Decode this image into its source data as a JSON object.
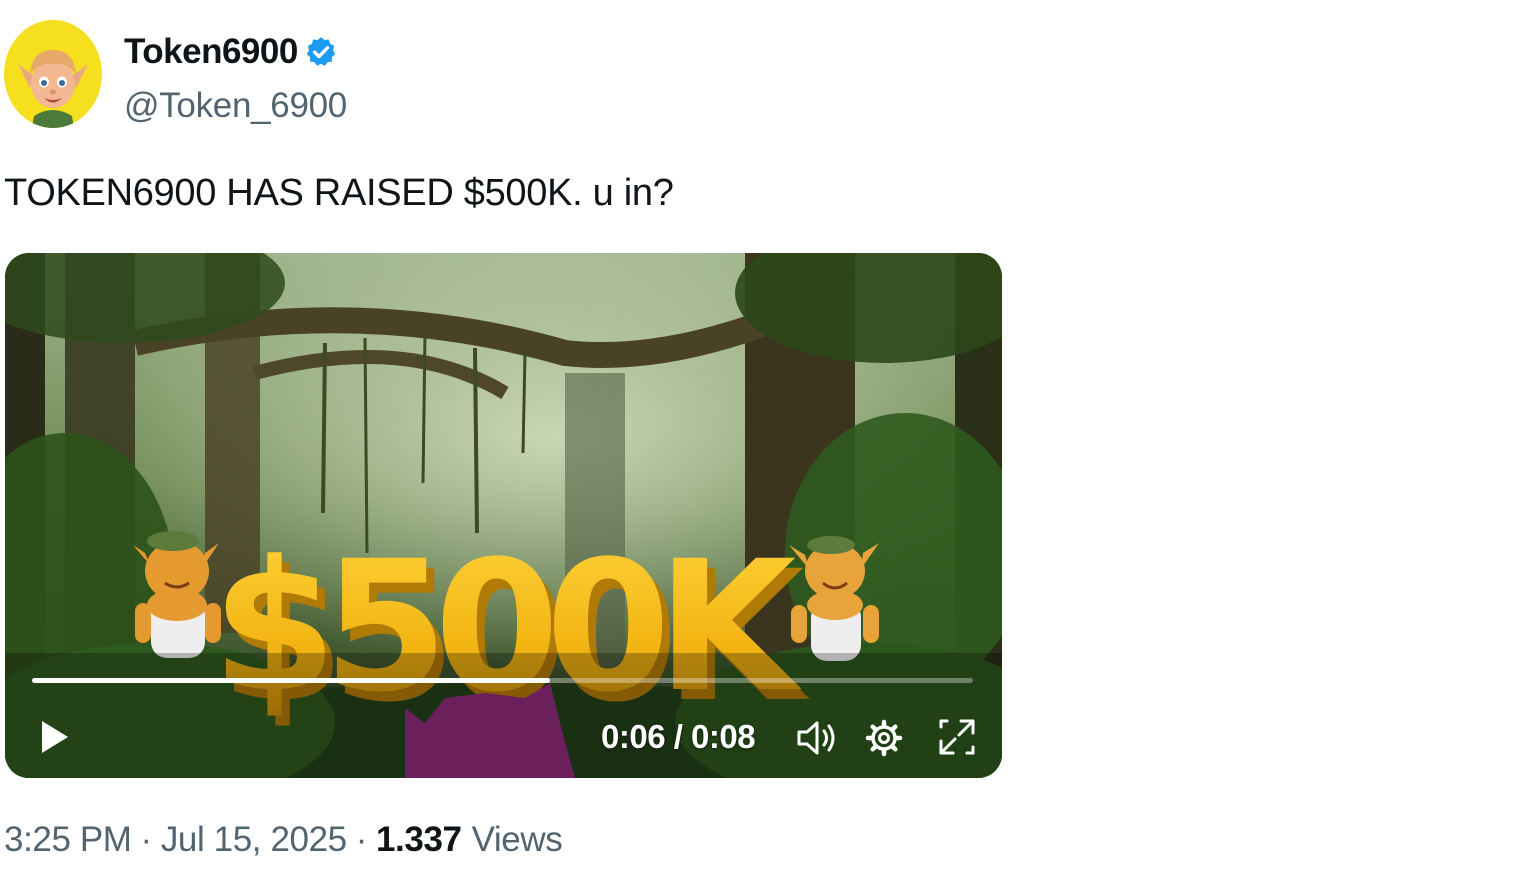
{
  "author": {
    "display_name": "Token6900",
    "handle": "@Token_6900",
    "verified": true,
    "avatar_icon": "elf-character-avatar"
  },
  "tweet": {
    "text": "TOKEN6900 HAS RAISED $500K. u in?"
  },
  "video": {
    "overlay_text": "$500K",
    "current_time": "0:06",
    "duration": "0:08",
    "time_display": "0:06 / 0:08",
    "progress_fraction": 0.55,
    "controls": [
      "play-icon",
      "volume-icon",
      "settings-gear-icon",
      "fullscreen-icon"
    ]
  },
  "meta": {
    "time": "3:25 PM",
    "date": "Jul 15, 2025",
    "separator": "·",
    "views_count": "1.337",
    "views_label": "Views"
  },
  "colors": {
    "verified_blue": "#1d9bf0",
    "secondary_text": "#536471",
    "primary_text": "#0f1419",
    "avatar_bg": "#f5df1e",
    "overlay_gold": "#f2b412"
  }
}
